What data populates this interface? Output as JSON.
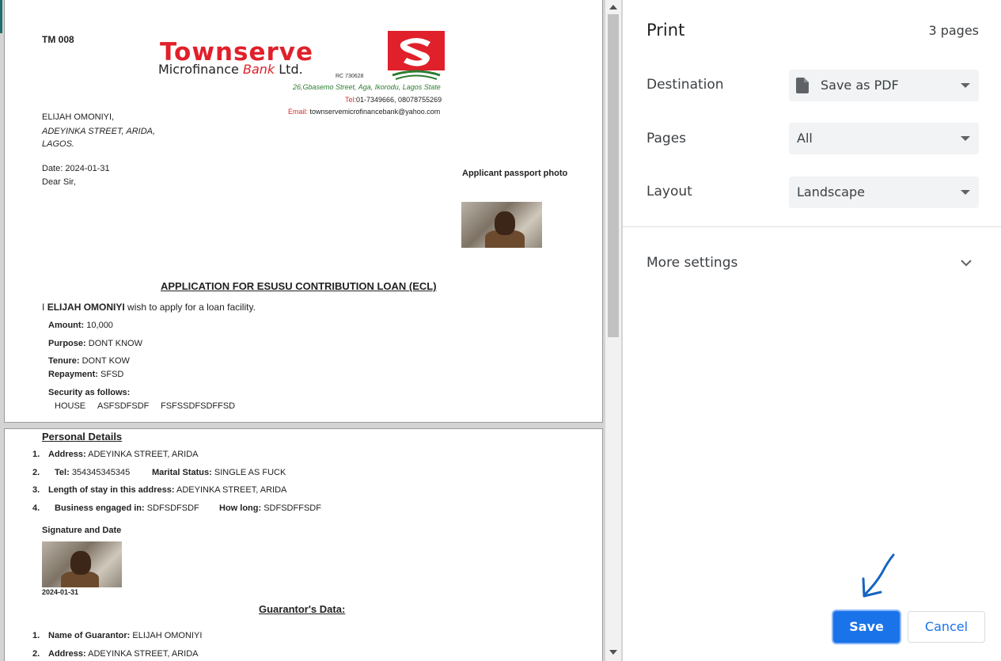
{
  "document": {
    "form_code": "TM 008",
    "bank": {
      "name_main": "Townserve",
      "name_sub_left": "Microfinance",
      "name_sub_bank": "Bank",
      "name_sub_ltd": "Ltd.",
      "rc": "RC 730628",
      "address": "26,Gbasemo Street, Aga, Ikorodu, Lagos State",
      "tel_label": "Tel:",
      "tel_value": "01-7349666, 08078755269",
      "email_label": "Email:",
      "email_value": "townservemicrofinancebank@yahoo.com"
    },
    "recipient": {
      "name": "ELIJAH OMONIYI,",
      "street": "ADEYINKA STREET, ARIDA,",
      "city": "LAGOS."
    },
    "date_line": "Date: 2024-01-31",
    "salutation": "Dear Sir,",
    "passport_label": "Applicant passport photo",
    "heading": "APPLICATION FOR ESUSU CONTRIBUTION LOAN (ECL)",
    "intro_prefix": "I",
    "intro_name": "ELIJAH OMONIYI",
    "intro_suffix": "wish to apply for a loan facility.",
    "amount_label": "Amount:",
    "amount_value": "10,000",
    "purpose_label": "Purpose:",
    "purpose_value": "DONT KNOW",
    "tenure_label": "Tenure:",
    "tenure_value": "DONT KOW",
    "repayment_label": "Repayment:",
    "repayment_value": "SFSD",
    "security_label": "Security as follows:",
    "security_items": [
      "HOUSE",
      "ASFSDFSDF",
      "FSFSSDFSDFFSD"
    ],
    "personal_heading": "Personal Details",
    "personal": {
      "n1": "1.",
      "address_label": "Address:",
      "address_value": "ADEYINKA STREET, ARIDA",
      "n2": "2.",
      "tel_label": "Tel:",
      "tel_value": "354345345345",
      "marital_label": "Marital Status:",
      "marital_value": "SINGLE AS FUCK",
      "n3": "3.",
      "stay_label": "Length of stay in this address:",
      "stay_value": "ADEYINKA STREET, ARIDA",
      "n4": "4.",
      "business_label": "Business engaged in:",
      "business_value": "SDFSDFSDF",
      "howlong_label": "How long:",
      "howlong_value": "SDFSDFFSDF"
    },
    "signature_label": "Signature and Date",
    "signature_date": "2024-01-31",
    "guarantor_heading": "Guarantor's Data:",
    "guarantor": {
      "n1": "1.",
      "name_label": "Name of Guarantor:",
      "name_value": "ELIJAH OMONIYI",
      "n2": "2.",
      "address_label": "Address:",
      "address_value": "ADEYINKA STREET, ARIDA"
    }
  },
  "print_panel": {
    "title": "Print",
    "page_count": "3 pages",
    "destination_label": "Destination",
    "destination_value": "Save as PDF",
    "pages_label": "Pages",
    "pages_value": "All",
    "layout_label": "Layout",
    "layout_value": "Landscape",
    "more_settings": "More settings",
    "save_button": "Save",
    "cancel_button": "Cancel",
    "accent_color": "#1a73e8"
  }
}
